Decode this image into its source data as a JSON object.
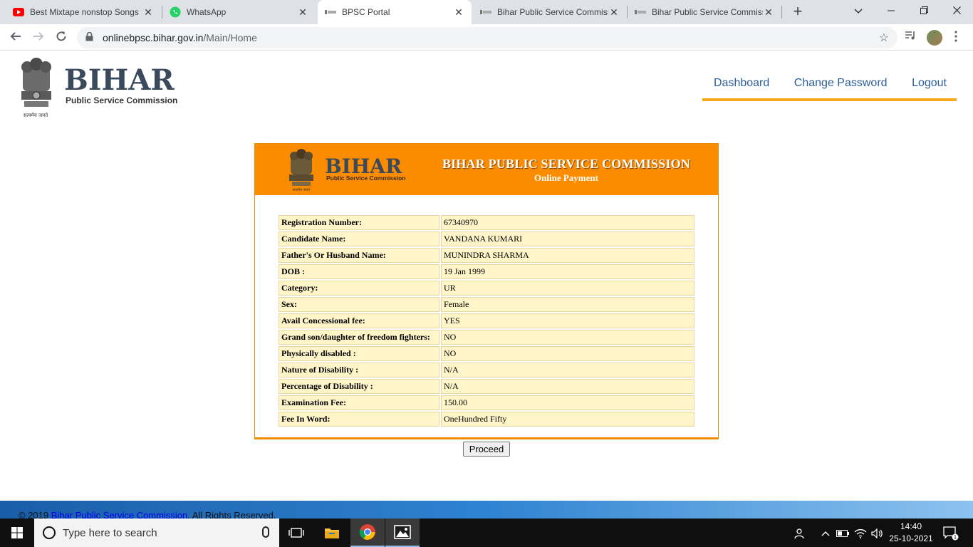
{
  "browser": {
    "tabs": [
      {
        "title": "Best Mixtape nonstop Songs",
        "icon": "youtube-icon"
      },
      {
        "title": "WhatsApp",
        "icon": "whatsapp-icon"
      },
      {
        "title": "BPSC Portal",
        "icon": "bpsc-favicon-icon",
        "active": true
      },
      {
        "title": "Bihar Public Service Commissi",
        "icon": "bpsc-favicon-icon"
      },
      {
        "title": "Bihar Public Service Commissi",
        "icon": "bpsc-favicon-icon"
      }
    ],
    "url_host": "onlinebpsc.bihar.gov.in",
    "url_path": "/Main/Home"
  },
  "site": {
    "logo_title": "BIHAR",
    "logo_subtitle": "Public Service Commission",
    "emblem_motto": "सत्यमेव जयते",
    "nav": [
      "Dashboard",
      "Change Password",
      "Logout"
    ]
  },
  "panel": {
    "heading": "BIHAR PUBLIC SERVICE COMMISSION",
    "subheading": "Online Payment",
    "rows": [
      {
        "label": "Registration Number:",
        "value": "67340970"
      },
      {
        "label": "Candidate Name:",
        "value": "VANDANA KUMARI"
      },
      {
        "label": "Father's Or Husband Name:",
        "value": "MUNINDRA SHARMA"
      },
      {
        "label": "DOB :",
        "value": "19 Jan 1999"
      },
      {
        "label": "Category:",
        "value": "UR"
      },
      {
        "label": "Sex:",
        "value": "Female"
      },
      {
        "label": "Avail Concessional fee:",
        "value": "YES"
      },
      {
        "label": "Grand son/daughter of freedom fighters:",
        "value": "NO"
      },
      {
        "label": "Physically disabled :",
        "value": "NO"
      },
      {
        "label": "Nature of Disability :",
        "value": "N/A"
      },
      {
        "label": "Percentage of Disability :",
        "value": "N/A"
      },
      {
        "label": "Examination Fee:",
        "value": "150.00"
      },
      {
        "label": "Fee In Word:",
        "value": "OneHundred Fifty"
      }
    ],
    "proceed_label": "Proceed"
  },
  "footer": {
    "prefix": "© 2019",
    "link": "Bihar Public Service Commission",
    "suffix": ". All Rights Reserved."
  },
  "taskbar": {
    "search_placeholder": "Type here to search",
    "time": "14:40",
    "date": "25-10-2021",
    "notification_count": "1"
  },
  "colors": {
    "orange_header": "#fb8c00",
    "nav_underline": "#f7a81b",
    "row_fill": "#fff5c9",
    "nav_link": "#2b5d9c"
  }
}
